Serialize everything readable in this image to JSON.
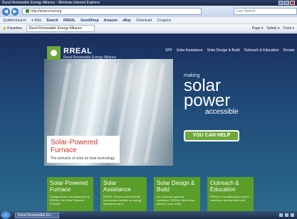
{
  "window": {
    "title": "Rural Renewable Energy Alliance - Windows Internet Explorer"
  },
  "browser": {
    "back_label": "◀",
    "forward_label": "▶",
    "url": "http://www.rreal.org",
    "search_placeholder": "Live Search",
    "toolbar_items": [
      "QuibbleSearch",
      "▾ Web",
      "Search",
      "RREAL",
      "GoodShop",
      "Amazon",
      "eBay",
      "Download",
      "Coupons"
    ],
    "favorites_label": "Favorites",
    "tab_title": "Rural Renewable Energy Alliance",
    "tools": [
      "Page ▾",
      "Safety ▾",
      "Tools ▾"
    ]
  },
  "site": {
    "logo_name": "RREAL",
    "logo_sub": "Rural Renewable Energy Alliance",
    "nav": [
      "SPF",
      "Solar Assistance",
      "Solar Design & Build",
      "Outreach & Education",
      "Donate"
    ],
    "tagline_small": "making",
    "tagline_solar": "solar",
    "tagline_power": "power",
    "tagline_accessible": "accessible",
    "help_button": "YOU CAN HELP",
    "featured_title": "Solar-Powered Furnace",
    "featured_sub": "The pinnacle of solar air heat technology.",
    "cards": [
      {
        "title": "Solar-Powered Furnace",
        "text": "Designed and manufactured by RREAL, the Solar Powered Furnace"
      },
      {
        "title": "Solar Assistance",
        "text": "RREAL delivers solar heat for low-income families on energy assistance as a"
      },
      {
        "title": "Solar Design & Build",
        "text": "As a licensed general contractor, RREAL offers solar electric, solar water"
      },
      {
        "title": "Outreach & Education",
        "text": "RREAL is contributing to green workforce development and"
      }
    ]
  },
  "taskbar": {
    "task": "Rural Renewable En..."
  }
}
